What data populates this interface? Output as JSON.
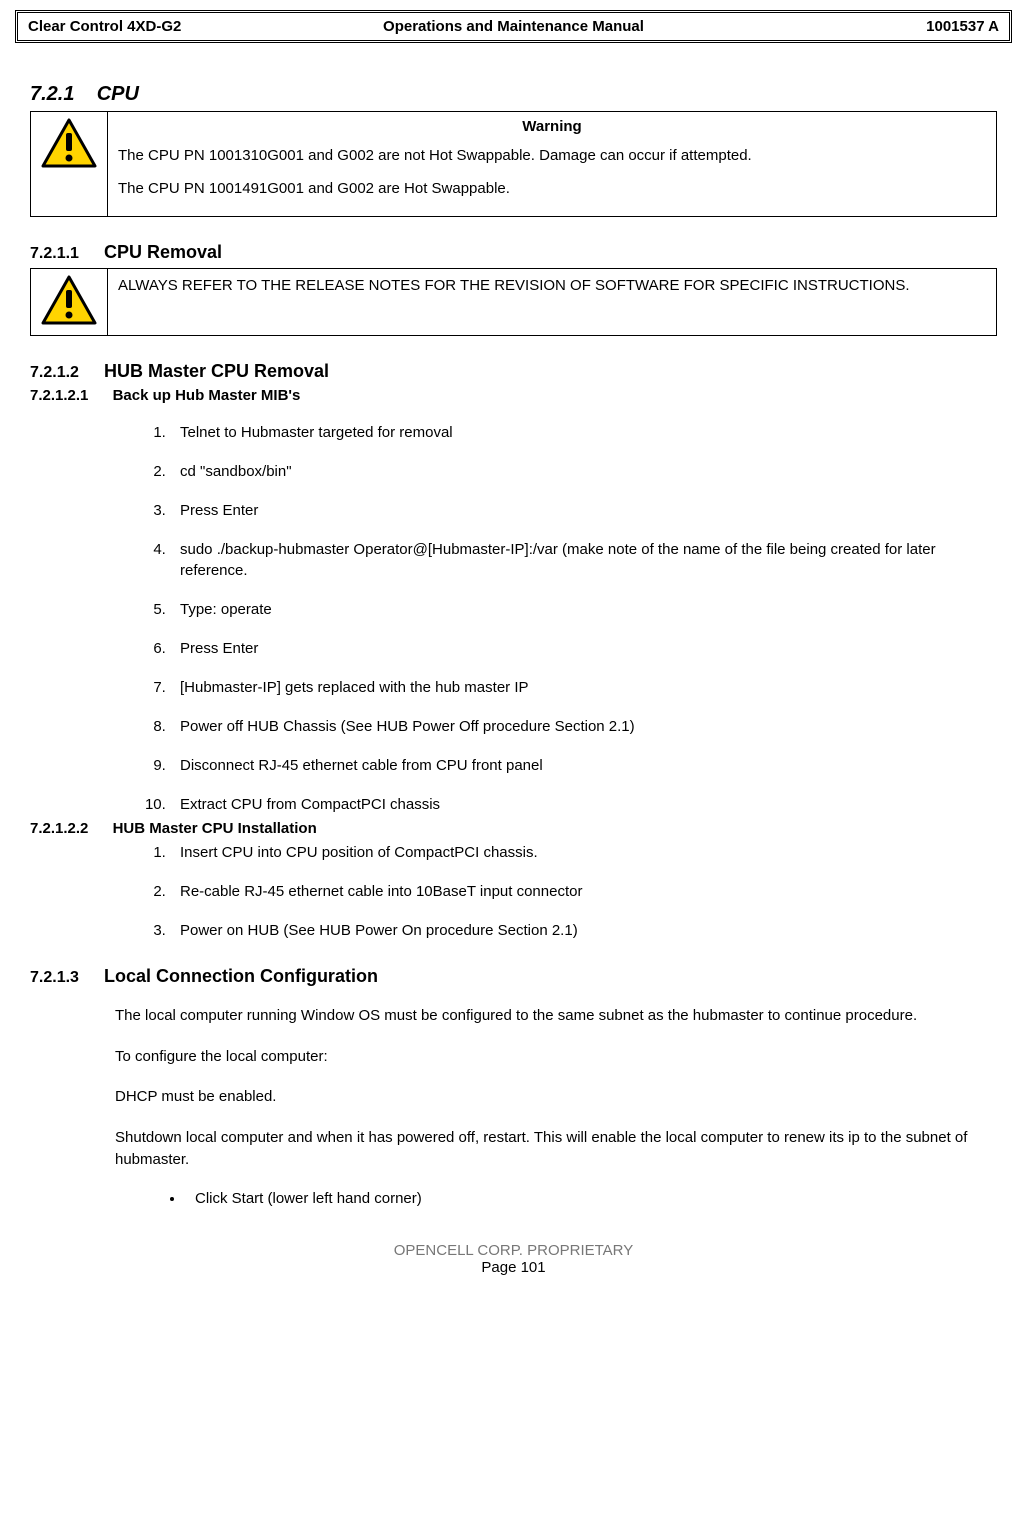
{
  "header": {
    "left": "Clear Control 4XD-G2",
    "center": "Operations and Maintenance Manual",
    "right": "1001537 A"
  },
  "s721": {
    "num": "7.2.1",
    "title": "CPU"
  },
  "warn1": {
    "title": "Warning",
    "line1": "The CPU PN 1001310G001 and G002 are not Hot Swappable.  Damage can occur if attempted.",
    "line2": "The CPU PN 1001491G001 and G002 are Hot Swappable."
  },
  "s7211": {
    "num": "7.2.1.1",
    "title": "CPU Removal"
  },
  "warn2": {
    "text": "ALWAYS REFER TO THE RELEASE NOTES FOR THE REVISION OF SOFTWARE FOR SPECIFIC INSTRUCTIONS."
  },
  "s7212": {
    "num": "7.2.1.2",
    "title": "HUB Master CPU Removal"
  },
  "s72121": {
    "num": "7.2.1.2.1",
    "title": "Back up Hub Master MIB's"
  },
  "steps1": [
    "Telnet to Hubmaster targeted for removal",
    "cd  \"sandbox/bin\"",
    "Press Enter",
    "sudo ./backup-hubmaster  Operator@[Hubmaster-IP]:/var (make note of the name of the file being created for later reference.",
    "Type: operate",
    "Press Enter",
    "[Hubmaster-IP] gets replaced with the hub master IP",
    "Power off HUB Chassis (See HUB Power Off procedure Section 2.1)",
    "Disconnect RJ-45 ethernet cable from CPU front panel",
    "Extract CPU from CompactPCI chassis"
  ],
  "s72122": {
    "num": "7.2.1.2.2",
    "title": "HUB Master CPU Installation"
  },
  "steps2": [
    "Insert CPU into CPU position of CompactPCI chassis.",
    "Re-cable RJ-45 ethernet cable into 10BaseT input connector",
    "Power on HUB (See HUB Power On procedure Section 2.1)"
  ],
  "s7213": {
    "num": "7.2.1.3",
    "title": "Local Connection Configuration"
  },
  "paras": [
    "The local computer running Window OS must be configured to the same subnet as the hubmaster to continue procedure.",
    "To configure the local computer:",
    "DHCP must be enabled.",
    "Shutdown local computer and when it has powered off, restart.  This will enable the local computer to renew its ip to the subnet of hubmaster."
  ],
  "bullets": [
    "Click Start (lower left hand corner)"
  ],
  "footer": {
    "line1": "OPENCELL CORP.  PROPRIETARY",
    "line2": "Page 101"
  }
}
